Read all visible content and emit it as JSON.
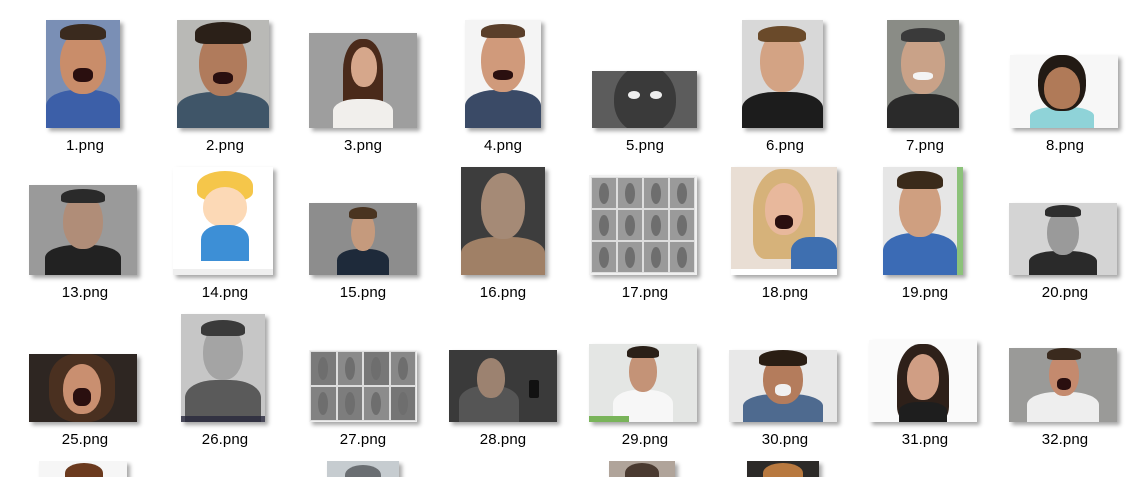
{
  "view": {
    "type": "file-explorer-large-icons",
    "background": "#ffffff"
  },
  "files": [
    {
      "name": "1.png"
    },
    {
      "name": "2.png"
    },
    {
      "name": "3.png"
    },
    {
      "name": "4.png"
    },
    {
      "name": "5.png"
    },
    {
      "name": "6.png"
    },
    {
      "name": "7.png"
    },
    {
      "name": "8.png"
    },
    {
      "name": "13.png"
    },
    {
      "name": "14.png"
    },
    {
      "name": "15.png"
    },
    {
      "name": "16.png"
    },
    {
      "name": "17.png"
    },
    {
      "name": "18.png"
    },
    {
      "name": "19.png"
    },
    {
      "name": "20.png"
    },
    {
      "name": "25.png"
    },
    {
      "name": "26.png"
    },
    {
      "name": "27.png"
    },
    {
      "name": "28.png"
    },
    {
      "name": "29.png"
    },
    {
      "name": "30.png"
    },
    {
      "name": "31.png"
    },
    {
      "name": "32.png"
    }
  ],
  "partial_row": {
    "visible_thumbnails": 4
  }
}
